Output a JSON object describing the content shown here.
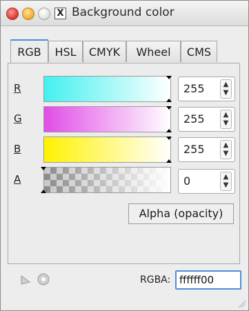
{
  "window": {
    "title": "Background color",
    "app_icon_glyph": "X"
  },
  "tabs": [
    {
      "label": "RGB",
      "active": true
    },
    {
      "label": "HSL",
      "active": false
    },
    {
      "label": "CMYK",
      "active": false
    },
    {
      "label": "Wheel",
      "active": false
    },
    {
      "label": "CMS",
      "active": false
    }
  ],
  "channels": [
    {
      "key": "r",
      "label": "R",
      "value": "255",
      "color": "#44f0f0"
    },
    {
      "key": "g",
      "label": "G",
      "value": "255",
      "color": "#e14de7"
    },
    {
      "key": "b",
      "label": "B",
      "value": "255",
      "color": "#fff200"
    },
    {
      "key": "a",
      "label": "A",
      "value": "0",
      "color": "checker"
    }
  ],
  "tooltip": {
    "alpha": "Alpha (opacity)"
  },
  "footer": {
    "rgba_label": "RGBA:",
    "rgba_value": "ffffff00"
  },
  "icons": {
    "eyedropper": "eyedropper-icon",
    "target": "target-icon"
  }
}
